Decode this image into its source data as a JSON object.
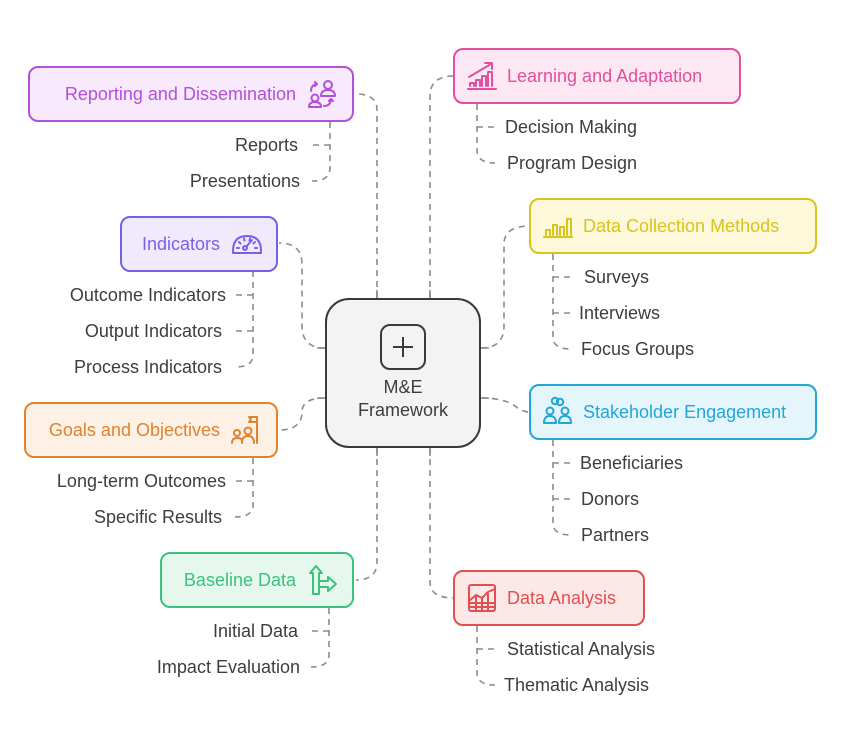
{
  "center": {
    "line1": "M&E",
    "line2": "Framework",
    "icon": "plus-square-icon"
  },
  "branches": {
    "reporting": {
      "label": "Reporting and Dissemination",
      "icon": "people-exchange-icon",
      "color": "#b44fd9",
      "bg": "#f8e9fd",
      "children": [
        "Reports",
        "Presentations"
      ]
    },
    "indicators": {
      "label": "Indicators",
      "icon": "gauge-icon",
      "color": "#7b5ee8",
      "bg": "#efebfd",
      "children": [
        "Outcome Indicators",
        "Output Indicators",
        "Process Indicators"
      ]
    },
    "goals": {
      "label": "Goals and Objectives",
      "icon": "team-flag-icon",
      "color": "#e0832f",
      "bg": "#fdf0e4",
      "children": [
        "Long-term Outcomes",
        "Specific Results"
      ]
    },
    "baseline": {
      "label": "Baseline Data",
      "icon": "split-arrows-icon",
      "color": "#3cc17e",
      "bg": "#e6f8ee",
      "children": [
        "Initial Data",
        "Impact Evaluation"
      ]
    },
    "learning": {
      "label": "Learning and Adaptation",
      "icon": "growth-chart-icon",
      "color": "#e0509e",
      "bg": "#fce7f3",
      "children": [
        "Decision Making",
        "Program Design"
      ]
    },
    "collection": {
      "label": "Data Collection Methods",
      "icon": "bar-chart-icon",
      "color": "#d8c41a",
      "bg": "#fdf8d9",
      "children": [
        "Surveys",
        "Interviews",
        "Focus Groups"
      ]
    },
    "stakeholder": {
      "label": "Stakeholder Engagement",
      "icon": "linked-people-icon",
      "color": "#22a6d8",
      "bg": "#e4f5fc",
      "children": [
        "Beneficiaries",
        "Donors",
        "Partners"
      ]
    },
    "analysis": {
      "label": "Data Analysis",
      "icon": "spreadsheet-chart-icon",
      "color": "#e05050",
      "bg": "#fde8e8",
      "children": [
        "Statistical Analysis",
        "Thematic Analysis"
      ]
    }
  }
}
